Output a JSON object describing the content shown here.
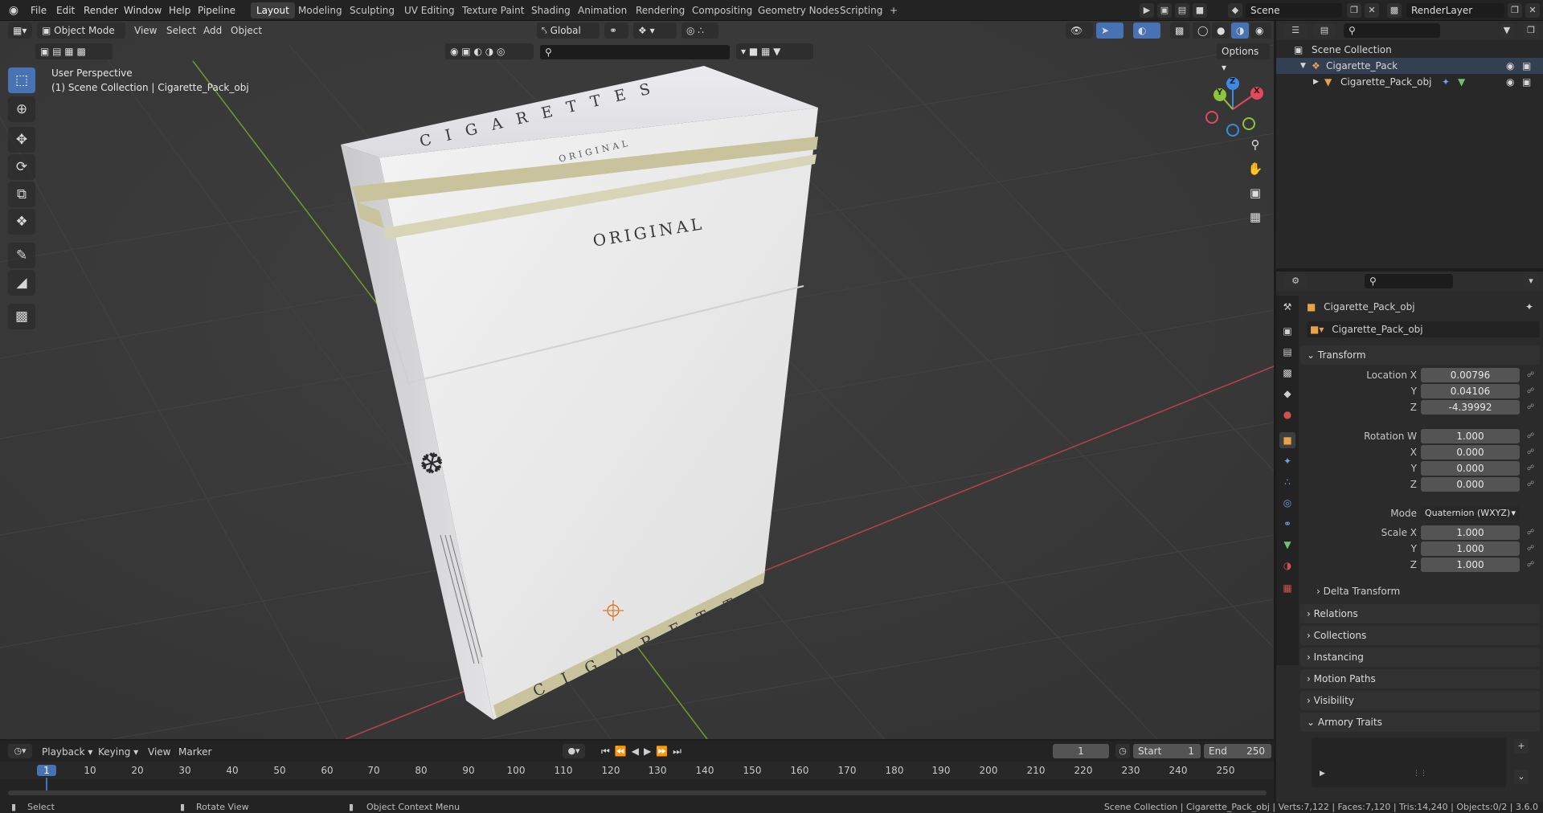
{
  "menubar": {
    "items": [
      "File",
      "Edit",
      "Render",
      "Window",
      "Help",
      "Pipeline"
    ],
    "workspaces": [
      "Layout",
      "Modeling",
      "Sculpting",
      "UV Editing",
      "Texture Paint",
      "Shading",
      "Animation",
      "Rendering",
      "Compositing",
      "Geometry Nodes",
      "Scripting"
    ],
    "add_workspace": "+",
    "scene_label": "Scene",
    "view_layer_label": "RenderLayer"
  },
  "viewport": {
    "mode_label": "Object Mode",
    "menus": [
      "View",
      "Select",
      "Add",
      "Object"
    ],
    "transform_orientation": "Global",
    "options_label": "Options",
    "info_line1": "User Perspective",
    "info_line2": "(1) Scene Collection | Cigarette_Pack_obj",
    "gizmo_axes": [
      "Z",
      "Y",
      "X"
    ],
    "pack_texts": {
      "top_brand": "C I G A R E T T E S",
      "top_sub": "ORIGINAL",
      "front_label": "ORIGINAL",
      "bottom_brand": "C I G A R E T T E S"
    }
  },
  "outliner": {
    "root": "Scene Collection",
    "items": [
      {
        "label": "Cigarette_Pack"
      },
      {
        "label": "Cigarette_Pack_obj"
      }
    ]
  },
  "properties": {
    "object_name": "Cigarette_Pack_obj",
    "data_name": "Cigarette_Pack_obj",
    "transform_title": "Transform",
    "location": {
      "label": "Location X",
      "x": "0.00796",
      "y": "0.04106",
      "z": "-4.39992"
    },
    "rotation": {
      "label": "Rotation W",
      "w": "1.000",
      "x": "0.000",
      "y": "0.000",
      "z": "0.000"
    },
    "axis_labels": {
      "x": "X",
      "y": "Y",
      "z": "Z"
    },
    "mode_label": "Mode",
    "mode_value": "Quaternion (WXYZ)",
    "scale": {
      "label": "Scale X",
      "x": "1.000",
      "y": "1.000",
      "z": "1.000"
    },
    "delta_transform": "Delta Transform",
    "sections": [
      "Relations",
      "Collections",
      "Instancing",
      "Motion Paths",
      "Visibility",
      "Armory Traits"
    ]
  },
  "timeline": {
    "menus": [
      "Playback",
      "Keying",
      "View",
      "Marker"
    ],
    "current_frame": "1",
    "start_label": "Start",
    "start_value": "1",
    "end_label": "End",
    "end_value": "250",
    "ticks": [
      "1",
      "10",
      "20",
      "30",
      "40",
      "50",
      "60",
      "70",
      "80",
      "90",
      "100",
      "110",
      "120",
      "130",
      "140",
      "150",
      "160",
      "170",
      "180",
      "190",
      "200",
      "210",
      "220",
      "230",
      "240",
      "250"
    ]
  },
  "statusbar": {
    "select": "Select",
    "rotate": "Rotate View",
    "context_menu": "Object Context Menu",
    "stats": "Scene Collection | Cigarette_Pack_obj | Verts:7,122 | Faces:7,120 | Tris:14,240 | Objects:0/2 | 3.6.0"
  },
  "colors": {
    "accent": "#4772b3",
    "axis_x": "#e04a5c",
    "axis_y": "#8cc43a",
    "axis_z": "#3c8be0",
    "pack_band": "#c8c39d"
  },
  "icons": [
    "blender-logo-icon",
    "select-box-icon",
    "cursor-icon",
    "move-icon",
    "rotate-icon",
    "scale-icon",
    "transform-icon",
    "annotate-icon",
    "measure-icon",
    "add-cube-icon",
    "zoom-icon",
    "hand-pan-icon",
    "camera-icon",
    "grid-icon",
    "eye-icon",
    "camera-render-icon",
    "wrench-icon",
    "filter-icon",
    "search-icon"
  ]
}
